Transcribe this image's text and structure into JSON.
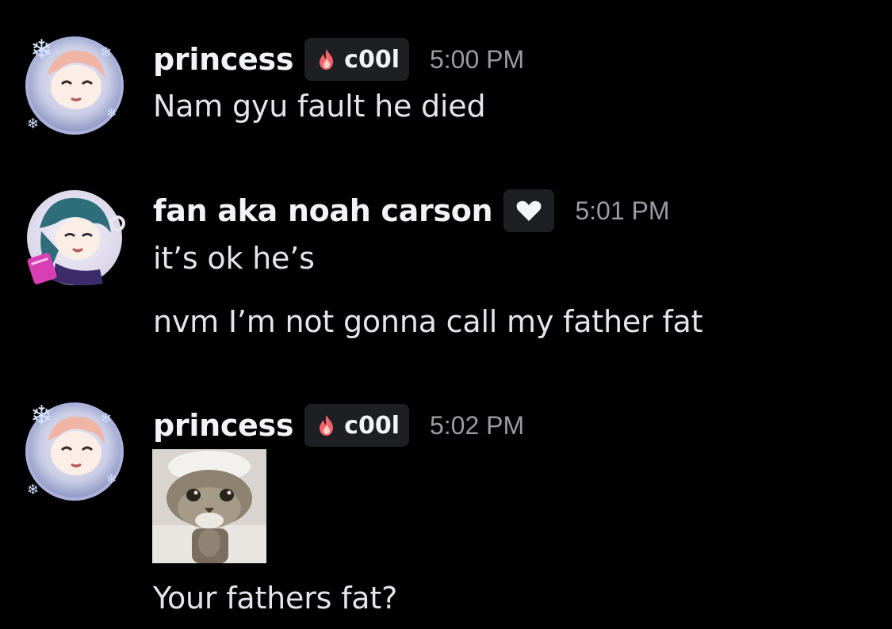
{
  "messages": [
    {
      "username": "princess",
      "tag": "c00l",
      "timestamp": "5:00 PM",
      "lines": [
        "Nam gyu fault he died"
      ],
      "avatar_icon": "anime-avatar-snowflake-icon",
      "tag_icon": "fire-icon"
    },
    {
      "username": "fan aka noah carson",
      "tag": "",
      "timestamp": "5:01 PM",
      "lines": [
        "it’s ok he’s",
        "nvm I’m not gonna call my father fat"
      ],
      "avatar_icon": "anime-avatar-headphones-icon",
      "tag_icon": "heart-icon"
    },
    {
      "username": "princess",
      "tag": "c00l",
      "timestamp": "5:02 PM",
      "attachment": "cat-image",
      "lines": [
        "Your fathers fat?"
      ],
      "avatar_icon": "anime-avatar-snowflake-icon",
      "tag_icon": "fire-icon"
    }
  ],
  "colors": {
    "background": "#000000",
    "username": "#f2f3f5",
    "message_text": "#e3e5e8",
    "timestamp": "#9a9ca3",
    "tag_background": "#1e1f22",
    "fire": "#f2636b"
  }
}
